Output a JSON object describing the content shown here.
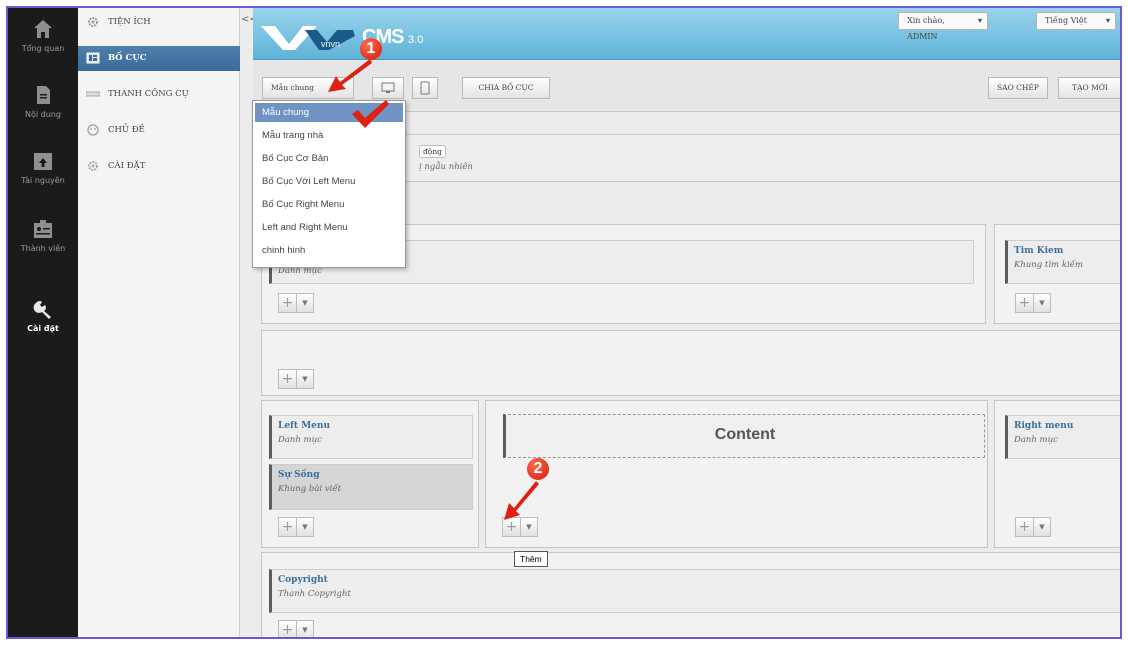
{
  "rail": {
    "items": [
      {
        "label": "Tổng quan",
        "icon": "home-icon"
      },
      {
        "label": "Nội dung",
        "icon": "document-icon"
      },
      {
        "label": "Tài nguyên",
        "icon": "upload-icon"
      },
      {
        "label": "Thành viên",
        "icon": "members-icon"
      },
      {
        "label": "Cài đặt",
        "icon": "wrench-icon"
      }
    ]
  },
  "sidebar": {
    "items": [
      {
        "label": "TIỆN ÍCH",
        "icon": "gear-icon"
      },
      {
        "label": "BỐ CỤC",
        "icon": "layout-icon"
      },
      {
        "label": "THANH CÔNG CỤ",
        "icon": "toolbar-icon"
      },
      {
        "label": "CHỦ ĐỀ",
        "icon": "theme-icon"
      },
      {
        "label": "CÀI ĐẶT",
        "icon": "settings-icon"
      }
    ],
    "collapse": "<<"
  },
  "header": {
    "logo_text": "vnvn",
    "product": "CMS",
    "version": "3.0",
    "greeting": "Xin chào, ADMIN",
    "language": "Tiếng Việt"
  },
  "toolbar": {
    "template_select": "Mẫu chung",
    "split_label": "CHIA BỐ CỤC",
    "copy_label": "SAO CHÉP",
    "new_label": "TẠO MỚI"
  },
  "dropdown": {
    "options": [
      "Mẫu chung",
      "Mẫu trang nhà",
      "Bố Cục Cơ Bản",
      "Bố Cục Với Left Menu",
      "Bố Cục Right Menu",
      "Left and Right Menu",
      "chinh hinh"
    ],
    "selected": "Mẫu chung"
  },
  "builder": {
    "banner_fragment_1": "động",
    "banner_fragment_2": "ị ngẫu nhiên",
    "cat_module_subtitle": "Danh mục",
    "search_module": {
      "title": "Tim Kiem",
      "subtitle": "Khung tìm kiếm"
    },
    "left_menu": {
      "title": "Left Menu",
      "subtitle": "Danh mục"
    },
    "life_module": {
      "title": "Sự Sống",
      "subtitle": "Khung bài viết"
    },
    "content_label": "Content",
    "right_menu": {
      "title": "Right menu",
      "subtitle": "Danh mục"
    },
    "copyright": {
      "title": "Copyright",
      "subtitle": "Thanh Copyright"
    },
    "tooltip": "Thêm"
  },
  "annotations": {
    "step1": "1",
    "step2": "2"
  },
  "colors": {
    "rail_bg": "#1b1b1b",
    "active_sidebar": "#3a6a97",
    "header_blue": "#5eb3d8",
    "annotation_red": "#e02010",
    "frame_border": "#6a5acd"
  }
}
